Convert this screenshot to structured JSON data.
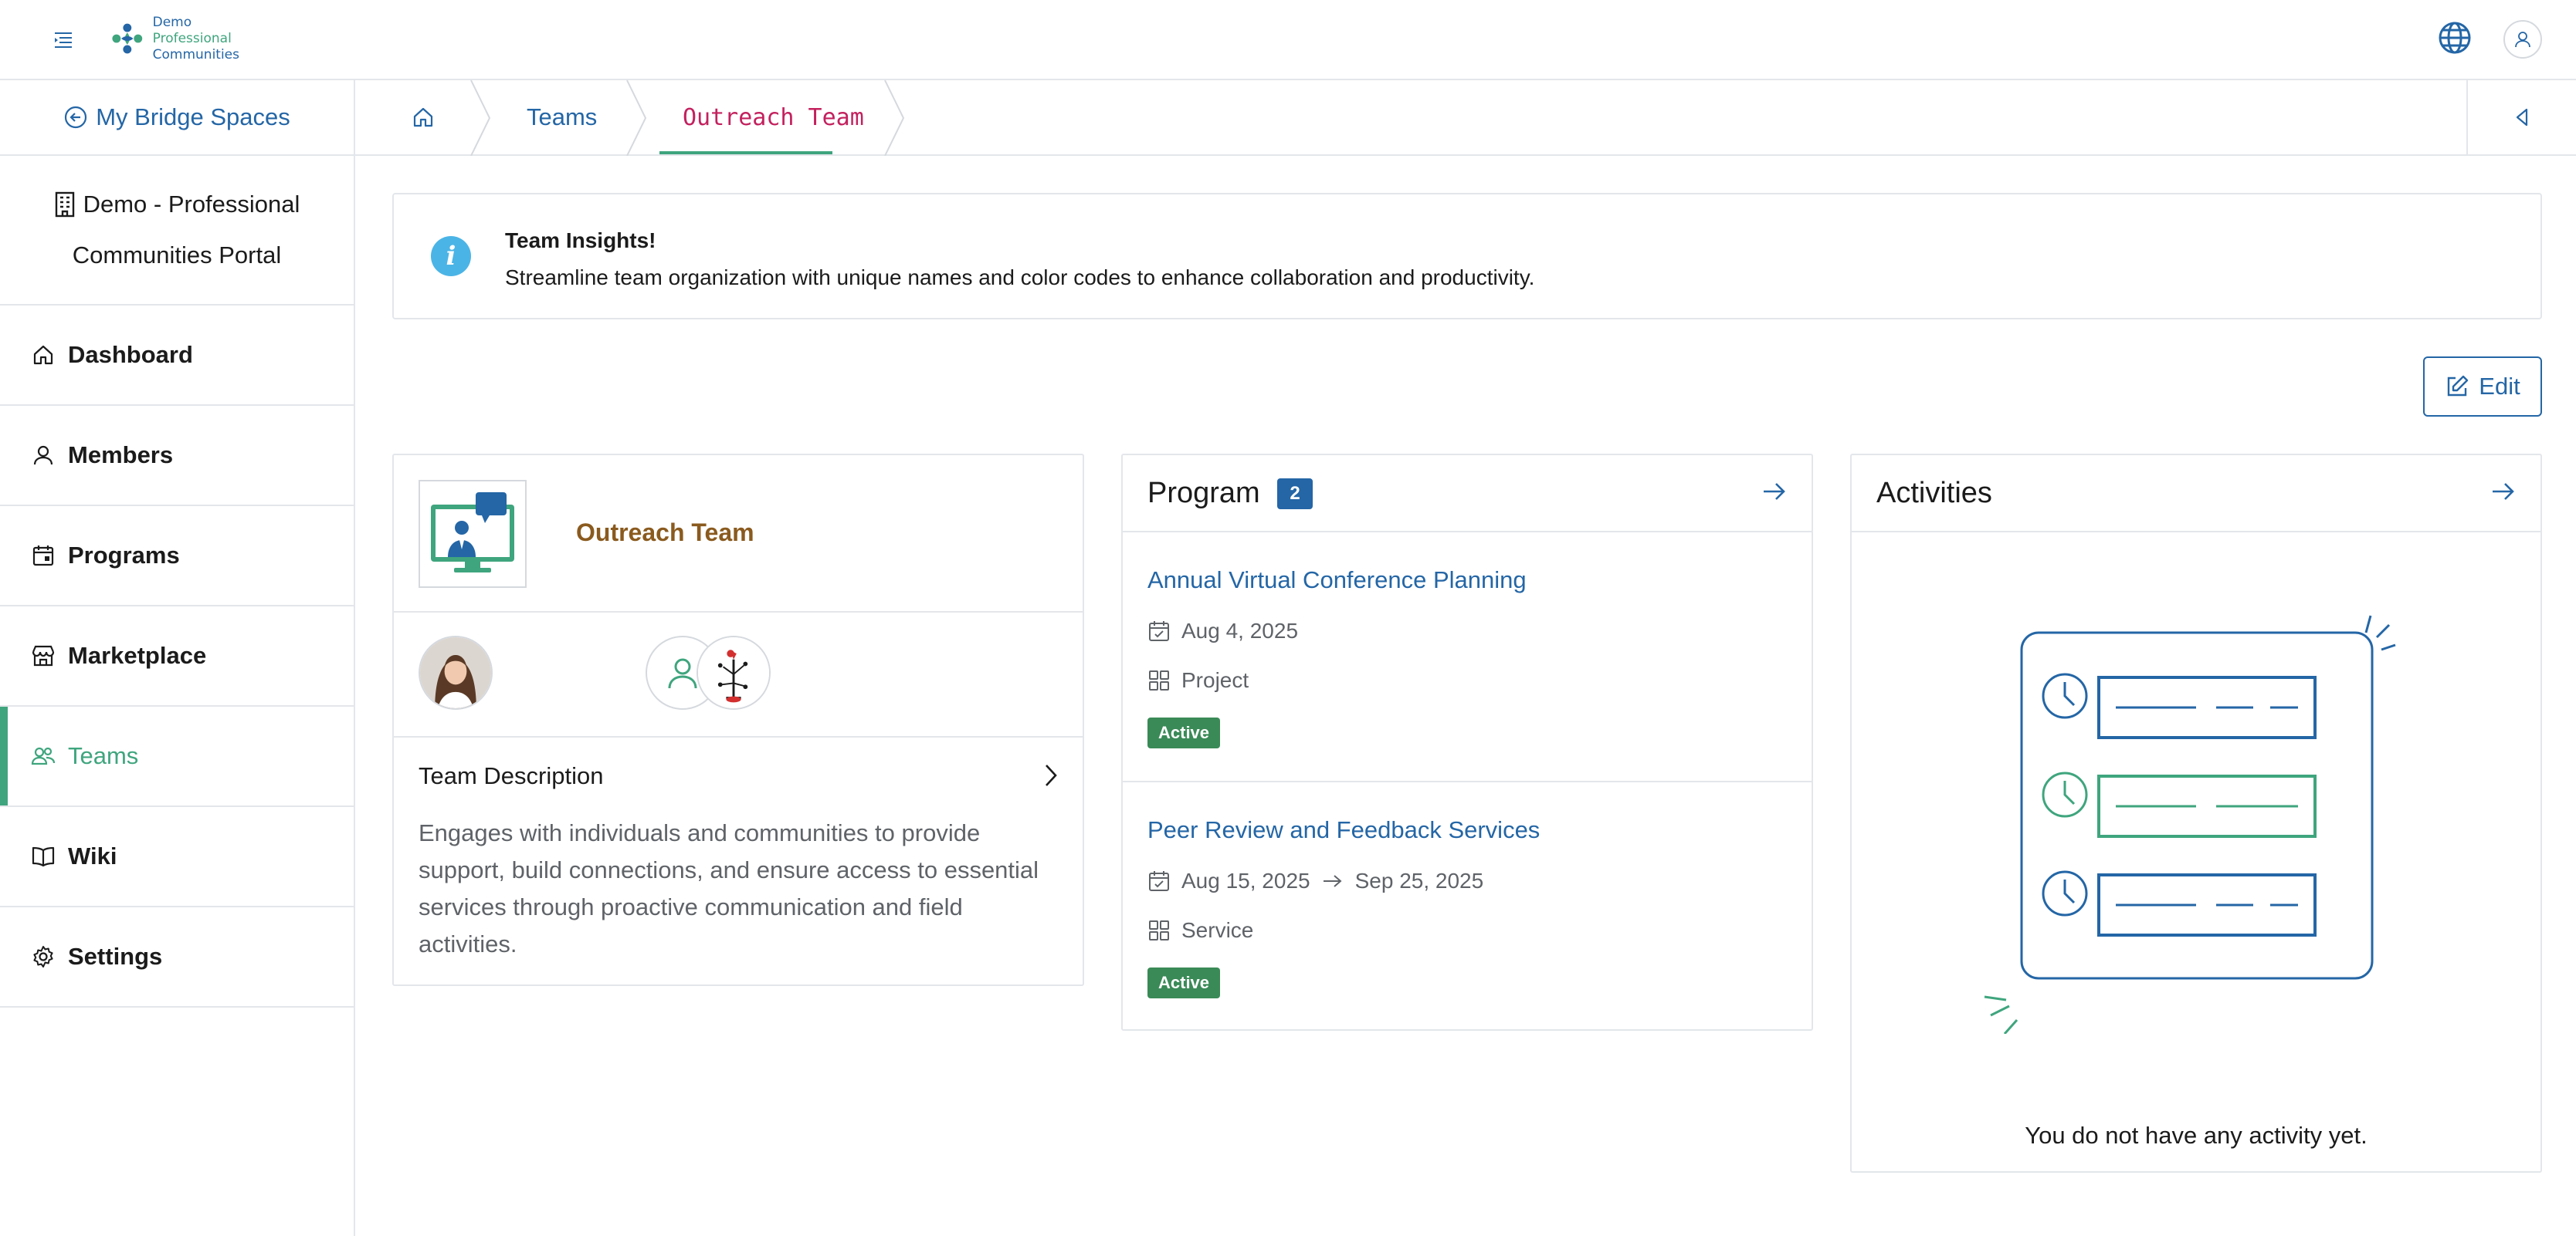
{
  "header": {
    "logo_line1": "Demo",
    "logo_line2": "Professional",
    "logo_line3": "Communities",
    "icons": [
      "menu-toggle-icon",
      "globe-icon",
      "user-icon"
    ]
  },
  "sidebar": {
    "back_label": "My Bridge Spaces",
    "org_line1": "Demo - Professional",
    "org_line2": "Communities Portal",
    "items": [
      {
        "label": "Dashboard",
        "icon": "home-icon"
      },
      {
        "label": "Members",
        "icon": "person-icon"
      },
      {
        "label": "Programs",
        "icon": "calendar-icon"
      },
      {
        "label": "Marketplace",
        "icon": "store-icon"
      },
      {
        "label": "Teams",
        "icon": "people-icon",
        "active": true
      },
      {
        "label": "Wiki",
        "icon": "book-icon"
      },
      {
        "label": "Settings",
        "icon": "gear-icon"
      }
    ]
  },
  "breadcrumb": {
    "teams": "Teams",
    "current": "Outreach Team"
  },
  "insight": {
    "title": "Team Insights!",
    "text": "Streamline team organization with unique names and color codes to enhance collaboration and productivity."
  },
  "actions": {
    "edit_label": "Edit"
  },
  "team": {
    "name": "Outreach Team",
    "description_heading": "Team Description",
    "description": "Engages with individuals and communities to provide support, build connections, and ensure access to essential services through proactive communication and field activities."
  },
  "programs": {
    "title": "Program",
    "count": "2",
    "items": [
      {
        "title": "Annual Virtual Conference Planning",
        "date": "Aug 4, 2025",
        "end_date": "",
        "type": "Project",
        "status": "Active"
      },
      {
        "title": "Peer Review and Feedback Services",
        "date": "Aug 15, 2025",
        "end_date": "Sep 25, 2025",
        "type": "Service",
        "status": "Active"
      }
    ]
  },
  "activities": {
    "title": "Activities",
    "empty_text": "You do not have any activity yet."
  },
  "colors": {
    "primary": "#2466a6",
    "accent": "#3fa57e",
    "crumb_current": "#c3215e",
    "status_active": "#3a8a57",
    "team_name": "#8a5a1e"
  }
}
